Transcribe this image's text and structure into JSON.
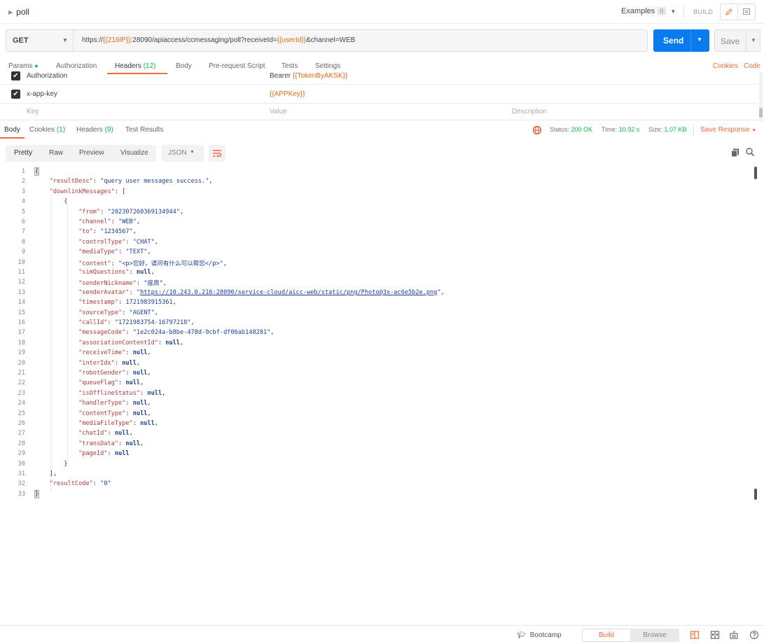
{
  "topbar": {
    "title": "poll",
    "examples_label": "Examples",
    "examples_count": "0",
    "build_label": "BUILD"
  },
  "request": {
    "method": "GET",
    "url_parts": [
      {
        "text": "https://",
        "var": false
      },
      {
        "text": "{{216IP}}",
        "var": true
      },
      {
        "text": ":28090/apiaccess/ccmessaging/poll?receiveId=",
        "var": false
      },
      {
        "text": "{{userId}}",
        "var": true
      },
      {
        "text": "&channel=WEB",
        "var": false
      }
    ],
    "send_label": "Send",
    "save_label": "Save"
  },
  "request_tabs": {
    "params": "Params",
    "authorization": "Authorization",
    "headers": "Headers",
    "headers_count": "(12)",
    "body": "Body",
    "prerequest": "Pre-request Script",
    "tests": "Tests",
    "settings": "Settings",
    "cookies": "Cookies",
    "code": "Code"
  },
  "headers_table": {
    "rows": [
      {
        "key": "Authorization",
        "value_prefix": "Bearer ",
        "value_var": "{{TokenByAKSK}}"
      },
      {
        "key": "x-app-key",
        "value_prefix": "",
        "value_var": "{{APPKey}}"
      }
    ],
    "placeholder_key": "Key",
    "placeholder_value": "Value",
    "placeholder_desc": "Description"
  },
  "response_tabs": {
    "body": "Body",
    "cookies": "Cookies",
    "cookies_count": "(1)",
    "headers": "Headers",
    "headers_count": "(9)",
    "test_results": "Test Results",
    "status_label": "Status:",
    "status_value": "200 OK",
    "time_label": "Time:",
    "time_value": "10.92 s",
    "size_label": "Size:",
    "size_value": "1.07 KB",
    "save_response": "Save Response"
  },
  "format_bar": {
    "pretty": "Pretty",
    "raw": "Raw",
    "preview": "Preview",
    "visualize": "Visualize",
    "format": "JSON"
  },
  "code_lines": [
    [
      [
        "p",
        "{"
      ]
    ],
    [
      [
        "p",
        "    "
      ],
      [
        "k",
        "\"resultDesc\""
      ],
      [
        "p",
        ": "
      ],
      [
        "s",
        "\"query user messages success.\""
      ],
      [
        "p",
        ","
      ]
    ],
    [
      [
        "p",
        "    "
      ],
      [
        "k",
        "\"downlinkMessages\""
      ],
      [
        "p",
        ": ["
      ]
    ],
    [
      [
        "p",
        "        {"
      ]
    ],
    [
      [
        "p",
        "            "
      ],
      [
        "k",
        "\"from\""
      ],
      [
        "p",
        ": "
      ],
      [
        "s",
        "\"202307260369134944\""
      ],
      [
        "p",
        ","
      ]
    ],
    [
      [
        "p",
        "            "
      ],
      [
        "k",
        "\"channel\""
      ],
      [
        "p",
        ": "
      ],
      [
        "s",
        "\"WEB\""
      ],
      [
        "p",
        ","
      ]
    ],
    [
      [
        "p",
        "            "
      ],
      [
        "k",
        "\"to\""
      ],
      [
        "p",
        ": "
      ],
      [
        "s",
        "\"1234567\""
      ],
      [
        "p",
        ","
      ]
    ],
    [
      [
        "p",
        "            "
      ],
      [
        "k",
        "\"controlType\""
      ],
      [
        "p",
        ": "
      ],
      [
        "s",
        "\"CHAT\""
      ],
      [
        "p",
        ","
      ]
    ],
    [
      [
        "p",
        "            "
      ],
      [
        "k",
        "\"mediaType\""
      ],
      [
        "p",
        ": "
      ],
      [
        "s",
        "\"TEXT\""
      ],
      [
        "p",
        ","
      ]
    ],
    [
      [
        "p",
        "            "
      ],
      [
        "k",
        "\"content\""
      ],
      [
        "p",
        ": "
      ],
      [
        "s",
        "\"<p>您好，请问有什么可以帮您</p>\""
      ],
      [
        "p",
        ","
      ]
    ],
    [
      [
        "p",
        "            "
      ],
      [
        "k",
        "\"simQuestions\""
      ],
      [
        "p",
        ": "
      ],
      [
        "nul",
        "null"
      ],
      [
        "p",
        ","
      ]
    ],
    [
      [
        "p",
        "            "
      ],
      [
        "k",
        "\"senderNickname\""
      ],
      [
        "p",
        ": "
      ],
      [
        "s",
        "\"座席\""
      ],
      [
        "p",
        ","
      ]
    ],
    [
      [
        "p",
        "            "
      ],
      [
        "k",
        "\"senderAvatar\""
      ],
      [
        "p",
        ": "
      ],
      [
        "s",
        "\""
      ],
      [
        "lnk",
        "https://10.243.0.216:28090/service-cloud/aicc-web/static/png/Photo@3x-ac6e5b2e.png"
      ],
      [
        "s",
        "\""
      ],
      [
        "p",
        ","
      ]
    ],
    [
      [
        "p",
        "            "
      ],
      [
        "k",
        "\"timestamp\""
      ],
      [
        "p",
        ": "
      ],
      [
        "n",
        "1721983915361"
      ],
      [
        "p",
        ","
      ]
    ],
    [
      [
        "p",
        "            "
      ],
      [
        "k",
        "\"sourceType\""
      ],
      [
        "p",
        ": "
      ],
      [
        "s",
        "\"AGENT\""
      ],
      [
        "p",
        ","
      ]
    ],
    [
      [
        "p",
        "            "
      ],
      [
        "k",
        "\"callId\""
      ],
      [
        "p",
        ": "
      ],
      [
        "s",
        "\"1721983754-16797218\""
      ],
      [
        "p",
        ","
      ]
    ],
    [
      [
        "p",
        "            "
      ],
      [
        "k",
        "\"messageCode\""
      ],
      [
        "p",
        ": "
      ],
      [
        "s",
        "\"1e2c024a-b8be-478d-9cbf-df06ab148281\""
      ],
      [
        "p",
        ","
      ]
    ],
    [
      [
        "p",
        "            "
      ],
      [
        "k",
        "\"associationContentId\""
      ],
      [
        "p",
        ": "
      ],
      [
        "nul",
        "null"
      ],
      [
        "p",
        ","
      ]
    ],
    [
      [
        "p",
        "            "
      ],
      [
        "k",
        "\"receiveTime\""
      ],
      [
        "p",
        ": "
      ],
      [
        "nul",
        "null"
      ],
      [
        "p",
        ","
      ]
    ],
    [
      [
        "p",
        "            "
      ],
      [
        "k",
        "\"interIdx\""
      ],
      [
        "p",
        ": "
      ],
      [
        "nul",
        "null"
      ],
      [
        "p",
        ","
      ]
    ],
    [
      [
        "p",
        "            "
      ],
      [
        "k",
        "\"robotGender\""
      ],
      [
        "p",
        ": "
      ],
      [
        "nul",
        "null"
      ],
      [
        "p",
        ","
      ]
    ],
    [
      [
        "p",
        "            "
      ],
      [
        "k",
        "\"queueFlag\""
      ],
      [
        "p",
        ": "
      ],
      [
        "nul",
        "null"
      ],
      [
        "p",
        ","
      ]
    ],
    [
      [
        "p",
        "            "
      ],
      [
        "k",
        "\"isOfflineStatus\""
      ],
      [
        "p",
        ": "
      ],
      [
        "nul",
        "null"
      ],
      [
        "p",
        ","
      ]
    ],
    [
      [
        "p",
        "            "
      ],
      [
        "k",
        "\"handlerType\""
      ],
      [
        "p",
        ": "
      ],
      [
        "nul",
        "null"
      ],
      [
        "p",
        ","
      ]
    ],
    [
      [
        "p",
        "            "
      ],
      [
        "k",
        "\"contentType\""
      ],
      [
        "p",
        ": "
      ],
      [
        "nul",
        "null"
      ],
      [
        "p",
        ","
      ]
    ],
    [
      [
        "p",
        "            "
      ],
      [
        "k",
        "\"mediaFileType\""
      ],
      [
        "p",
        ": "
      ],
      [
        "nul",
        "null"
      ],
      [
        "p",
        ","
      ]
    ],
    [
      [
        "p",
        "            "
      ],
      [
        "k",
        "\"chatId\""
      ],
      [
        "p",
        ": "
      ],
      [
        "nul",
        "null"
      ],
      [
        "p",
        ","
      ]
    ],
    [
      [
        "p",
        "            "
      ],
      [
        "k",
        "\"transData\""
      ],
      [
        "p",
        ": "
      ],
      [
        "nul",
        "null"
      ],
      [
        "p",
        ","
      ]
    ],
    [
      [
        "p",
        "            "
      ],
      [
        "k",
        "\"pageId\""
      ],
      [
        "p",
        ": "
      ],
      [
        "nul",
        "null"
      ]
    ],
    [
      [
        "p",
        "        }"
      ]
    ],
    [
      [
        "p",
        "    ],"
      ]
    ],
    [
      [
        "p",
        "    "
      ],
      [
        "k",
        "\"resultCode\""
      ],
      [
        "p",
        ": "
      ],
      [
        "s",
        "\"0\""
      ]
    ],
    [
      [
        "p",
        "}"
      ]
    ]
  ],
  "bottombar": {
    "bootcamp": "Bootcamp",
    "build": "Build",
    "browse": "Browse"
  },
  "colors": {
    "accent_orange": "#f26b3a",
    "send_blue": "#097bed",
    "status_green": "#0cbb52",
    "variable_orange": "#e36b16"
  }
}
